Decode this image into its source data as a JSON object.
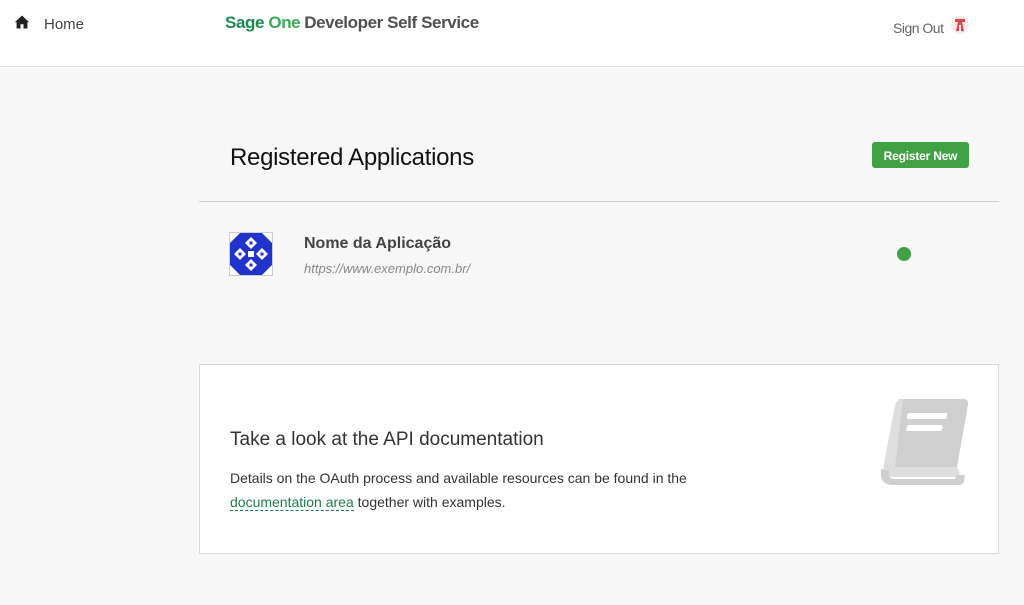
{
  "header": {
    "home_label": "Home",
    "brand": {
      "sage": "Sage",
      "one": "One",
      "rest": "Developer Self Service"
    },
    "signout_label": "Sign Out"
  },
  "main": {
    "title": "Registered Applications",
    "register_button": "Register New",
    "applications": [
      {
        "name": "Nome da Aplicação",
        "url": "https://www.exemplo.com.br/",
        "status_color": "#41a145"
      }
    ]
  },
  "docs": {
    "title": "Take a look at the API documentation",
    "text_before": "Details on the OAuth process and available resources can be found in the",
    "link_text": "documentation area",
    "text_after": "together with examples."
  },
  "colors": {
    "accent": "#41a145",
    "brand_green": "#1b8a4f",
    "link": "#1b7f4a"
  },
  "icons": [
    "home-icon",
    "signout-icon",
    "app-logo-icon",
    "book-icon"
  ]
}
